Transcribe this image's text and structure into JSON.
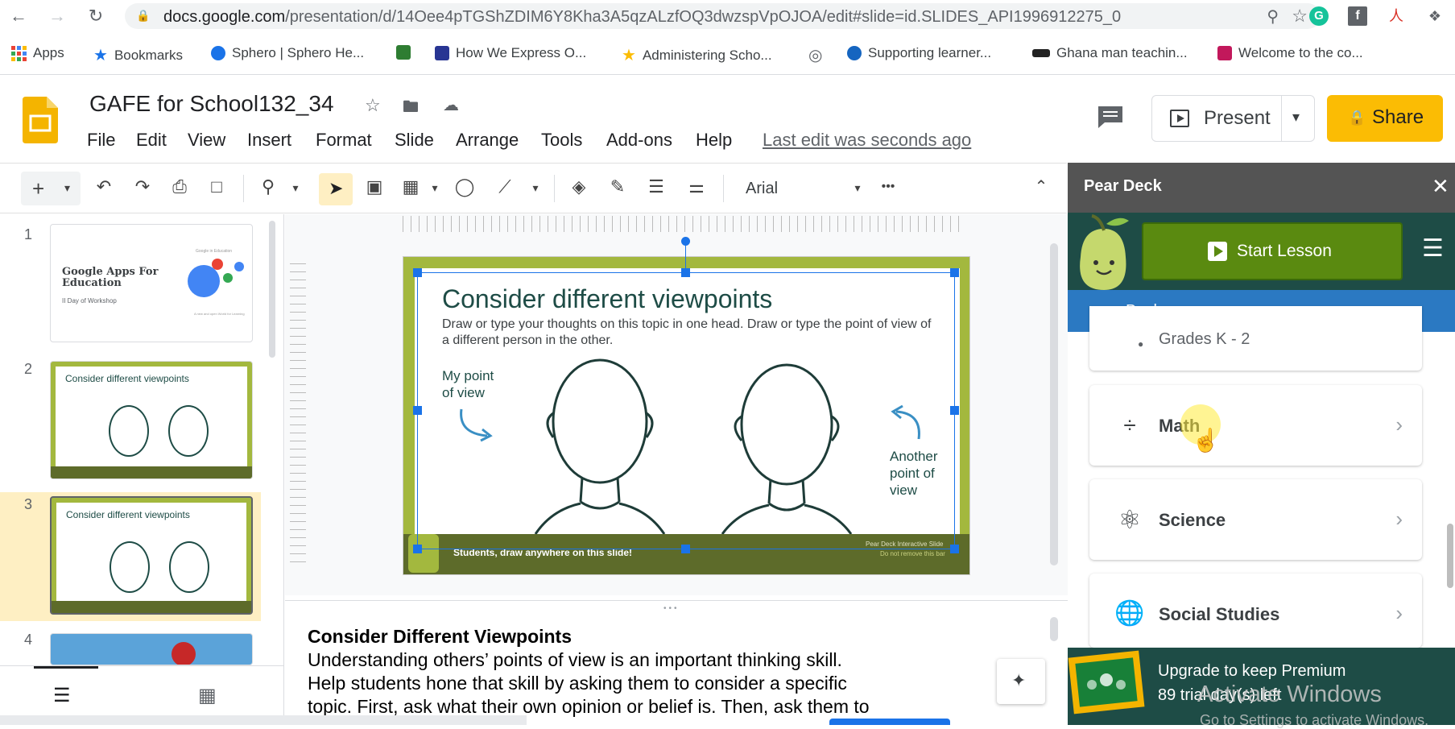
{
  "browser": {
    "url_host": "docs.google.com",
    "url_path": "/presentation/d/14Oee4pTGShZDIM6Y8Kha3A5qzALzfOQ3dwzspVpOJOA/edit#slide=id.SLIDES_API1996912275_0",
    "bookmarks": [
      {
        "label": "Apps"
      },
      {
        "label": "Bookmarks"
      },
      {
        "label": "Sphero | Sphero He..."
      },
      {
        "label": ""
      },
      {
        "label": "How We Express O..."
      },
      {
        "label": "Administering Scho..."
      },
      {
        "label": ""
      },
      {
        "label": "Supporting learner..."
      },
      {
        "label": "Ghana man teachin..."
      },
      {
        "label": "Welcome to the co..."
      }
    ]
  },
  "doc": {
    "title": "GAFE for School132_34",
    "menu": [
      "File",
      "Edit",
      "View",
      "Insert",
      "Format",
      "Slide",
      "Arrange",
      "Tools",
      "Add-ons",
      "Help"
    ],
    "last_edit": "Last edit was seconds ago",
    "present_label": "Present",
    "share_label": "Share"
  },
  "toolbar": {
    "font": "Arial",
    "more": "•••"
  },
  "filmstrip": {
    "slides": [
      {
        "num": "1",
        "title": "Google Apps For Education",
        "subtitle": "II Day of Workshop",
        "tag": "Google in Education",
        "caption": "A new and open World for Learning"
      },
      {
        "num": "2",
        "title": "Consider different viewpoints"
      },
      {
        "num": "3",
        "title": "Consider different viewpoints"
      },
      {
        "num": "4",
        "title": ""
      }
    ]
  },
  "slide": {
    "title": "Consider different viewpoints",
    "body": "Draw or type your thoughts on this topic in one head. Draw or type the point of view of a different person in the other.",
    "left_label_1": "My point",
    "left_label_2": "of view",
    "right_label_1": "Another",
    "right_label_2": "point of",
    "right_label_3": "view",
    "footer": "Students, draw anywhere on this slide!",
    "footer_right_1": "Pear Deck Interactive Slide",
    "footer_right_2": "Do not remove this bar"
  },
  "notes": {
    "heading": "Consider Different Viewpoints",
    "line1": "Understanding others’ points of view is an important thinking skill.",
    "line2": "Help students hone that skill by asking them to consider a specific",
    "line3": "topic. First, ask what their own opinion or belief is. Then, ask them to"
  },
  "peardeck": {
    "title": "Pear Deck",
    "start_lesson": "Start Lesson",
    "back": "Back",
    "partial_item": "Grades K - 2",
    "items": [
      "Math",
      "Science",
      "Social Studies"
    ],
    "upgrade_title": "Upgrade to keep Premium",
    "upgrade_sub": "89 trial day(s) left"
  },
  "watermark": {
    "line1": "Activate Windows",
    "line2": "Go to Settings to activate Windows."
  },
  "colors": {
    "share_yellow": "#fbbc04",
    "pear_green": "#1e4c46",
    "start_green": "#5a8a10",
    "back_blue": "#2b79c2",
    "slide_border": "#a3b83e",
    "selection": "#1a73e8"
  }
}
